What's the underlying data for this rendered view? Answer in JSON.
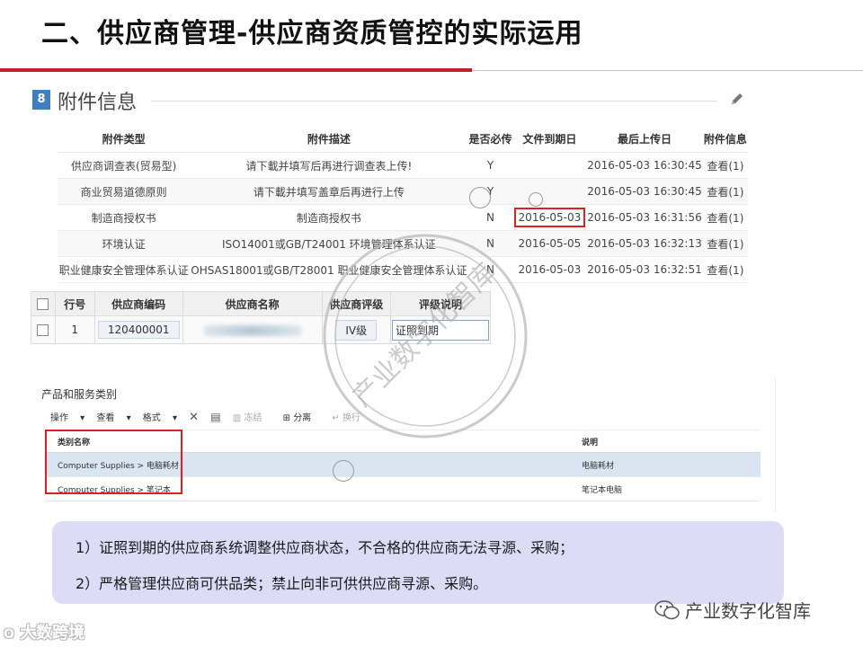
{
  "slide": {
    "title": "二、供应商管理-供应商资质管控的实际运用"
  },
  "attachments": {
    "section_number": "8",
    "section_title": "附件信息",
    "columns": [
      "附件类型",
      "附件描述",
      "是否必传",
      "文件到期日",
      "最后上传日",
      "附件信息"
    ],
    "rows": [
      {
        "type": "供应商调查表(贸易型)",
        "desc": "请下載并填写后再进行调查表上传!",
        "required": "Y",
        "expiry": "",
        "uploaded": "2016-05-03 16:30:45",
        "info": "查看(1)"
      },
      {
        "type": "商业贸易道德原则",
        "desc": "请下載并填写盖章后再进行上传",
        "required": "Y",
        "expiry": "",
        "uploaded": "2016-05-03 16:30:45",
        "info": "查看(1)"
      },
      {
        "type": "制造商授权书",
        "desc": "制造商授权书",
        "required": "N",
        "expiry": "2016-05-03",
        "uploaded": "2016-05-03 16:31:56",
        "info": "查看(1)"
      },
      {
        "type": "环境认证",
        "desc": "ISO14001或GB/T24001 环境管理体系认证",
        "required": "N",
        "expiry": "2016-05-05",
        "uploaded": "2016-05-03 16:32:13",
        "info": "查看(1)"
      },
      {
        "type": "职业健康安全管理体系认证",
        "desc": "OHSAS18001或GB/T28001 职业健康安全管理体系认证",
        "required": "N",
        "expiry": "2016-05-03",
        "uploaded": "2016-05-03 16:32:51",
        "info": "查看(1)"
      }
    ]
  },
  "supplier_grade": {
    "columns": [
      "行号",
      "供应商编码",
      "供应商名称",
      "供应商评级",
      "评级说明"
    ],
    "row": {
      "line": "1",
      "code": "120400001",
      "name": "",
      "grade": "IV级",
      "reason": "证照到期"
    }
  },
  "products": {
    "title": "产品和服务类别",
    "toolbar": {
      "operate": "操作",
      "view": "查看",
      "format": "格式",
      "freeze": "冻结",
      "split": "分离",
      "wrap": "换行"
    },
    "columns": [
      "类别名称",
      "说明"
    ],
    "rows": [
      {
        "category": "Computer Supplies > 电脑耗材",
        "note": "电脑耗材"
      },
      {
        "category": "Computer Supplies > 笔记本",
        "note": "笔记本电脑"
      }
    ]
  },
  "notes": [
    "1）证照到期的供应商系统调整供应商状态，不合格的供应商无法寻源、采购；",
    "2）严格管理供应商可供品类；禁止向非可供供应商寻源、采购。"
  ],
  "watermarks": {
    "stamp_text": "产业数字化智库",
    "footer_text": "产业数字化智库",
    "corner_logo": "大数跨境"
  },
  "icons": {
    "edit": "pencil-icon",
    "delete": "close-x-icon",
    "export": "export-icon"
  },
  "colors": {
    "title_rule": "#c0212b",
    "section_badge": "#3d7fc1",
    "highlight_frame": "#e02020",
    "notes_bg": "#dcdcf7",
    "selected_row": "#d9e5f0"
  }
}
